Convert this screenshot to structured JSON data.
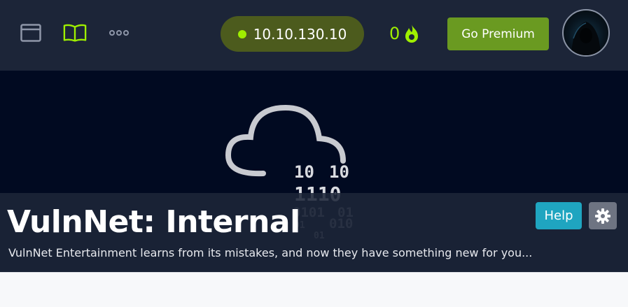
{
  "header": {
    "vpn_ip": "10.10.130.10",
    "streak_count": "0",
    "premium_label": "Go Premium",
    "icons": [
      "browser-window-icon",
      "book-icon",
      "more-dots-icon",
      "fire-icon"
    ],
    "colors": {
      "accent_green": "#9fef00",
      "premium_green": "#6a9a21",
      "ip_pill": "#4c5b1d",
      "navbar": "#1c2538"
    }
  },
  "room": {
    "title": "VulnNet: Internal",
    "description": "VulnNet Entertainment learns from its mistakes, and now they have something new for you...",
    "help_label": "Help",
    "badge_binary": [
      "10",
      "10",
      "1110",
      "0101",
      "01",
      "01",
      "010",
      "01"
    ],
    "colors": {
      "help": "#1fa5c0",
      "hero_bg": "#010a21"
    }
  }
}
